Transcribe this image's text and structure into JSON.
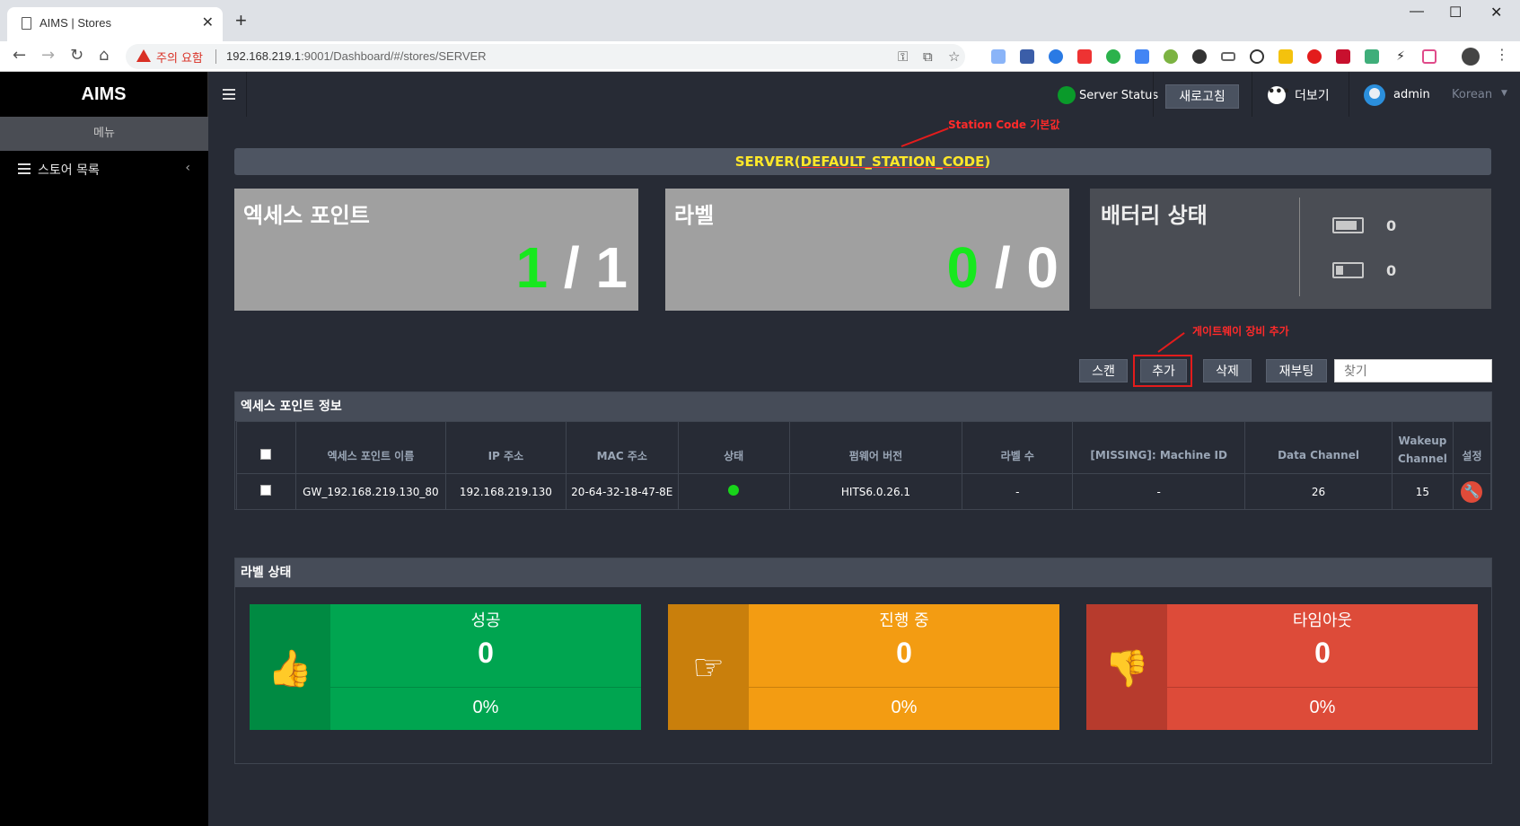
{
  "browser": {
    "tab_title": "AIMS | Stores",
    "tab_close": "✕",
    "new_tab": "+",
    "security_warning": "주의 요함",
    "url_host": "192.168.219.1",
    "url_path": ":9001/Dashboard/#/stores/SERVER",
    "minimize": "—",
    "maximize": "☐",
    "close": "✕"
  },
  "sidebar": {
    "brand": "AIMS",
    "menu_header": "메뉴",
    "items": [
      {
        "label": "스토어 목록",
        "chevron": "‹"
      }
    ]
  },
  "header": {
    "server_status": "Server Status",
    "refresh": "새로고침",
    "more": "더보기",
    "more_icon_text": "•••",
    "user": "admin",
    "language": "Korean",
    "lang_arrow": "▼"
  },
  "annotations": {
    "station_code_note": "Station Code 기본값",
    "gateway_add_note": "게이트웨이 장비 추가"
  },
  "station": {
    "prefix": "SERVER(",
    "code": "DEFAULT_STATION_CODE",
    "suffix": ")"
  },
  "stats": {
    "access_point": {
      "title": "엑세스 포인트",
      "online": "1",
      "sep": " / ",
      "total": "1"
    },
    "labels": {
      "title": "라벨",
      "online": "0",
      "sep": " / ",
      "total": "0"
    },
    "battery": {
      "title": "배터리 상태",
      "good_count": "0",
      "low_count": "0",
      "good_level": 0.85,
      "low_level": 0.3
    }
  },
  "actions": {
    "scan": "스캔",
    "add": "추가",
    "delete": "삭제",
    "reboot": "재부팅",
    "search_placeholder": "찾기"
  },
  "ap_table": {
    "panel_title": "엑세스 포인트 정보",
    "columns": [
      "엑세스 포인트 이름",
      "IP 주소",
      "MAC 주소",
      "상태",
      "펌웨어 버전",
      "라벨 수",
      "[MISSING]: Machine ID",
      "Data Channel",
      "Wakeup Channel",
      "설정"
    ],
    "rows": [
      {
        "name": "GW_192.168.219.130_80",
        "ip": "192.168.219.130",
        "mac": "20-64-32-18-47-8E",
        "status": "online",
        "firmware": "HITS6.0.26.1",
        "label_count": "-",
        "machine_id": "-",
        "data_channel": "26",
        "wakeup_channel": "15"
      }
    ]
  },
  "label_status": {
    "panel_title": "라벨 상태",
    "cards": [
      {
        "label": "성공",
        "count": "0",
        "percent": "0%",
        "icon": "thumbs-up-icon",
        "glyph": "👍",
        "color": "#00a550",
        "dark": "#008a42"
      },
      {
        "label": "진행 중",
        "count": "0",
        "percent": "0%",
        "icon": "pointing-hand-icon",
        "glyph": "☞",
        "color": "#f39c12",
        "dark": "#c97f0c"
      },
      {
        "label": "타임아웃",
        "count": "0",
        "percent": "0%",
        "icon": "thumbs-down-icon",
        "glyph": "👎",
        "color": "#dd4b39",
        "dark": "#b73b2d"
      }
    ]
  },
  "colors": {
    "accent_green": "#17e81e",
    "station_text": "#ffe829",
    "annotation_red": "#ff2a2a"
  }
}
